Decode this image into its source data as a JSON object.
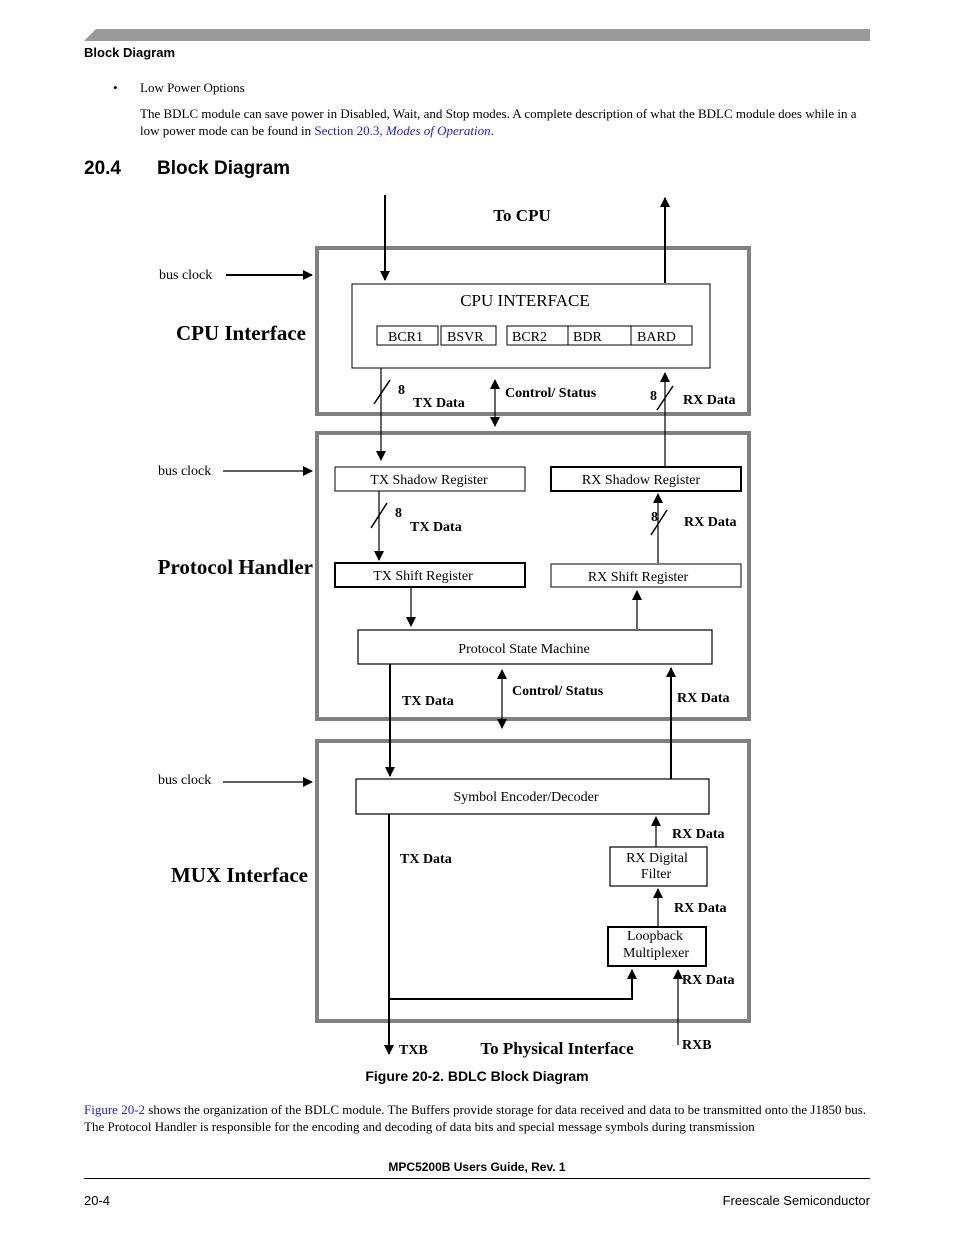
{
  "page": {
    "running_head": "Block Diagram",
    "bullet_char": "•",
    "bullet_label": "Low Power Options",
    "intro_text_1": "The BDLC module can save power in Disabled, Wait, and Stop modes. A complete description of what the BDLC module does while in a low power mode can be found in ",
    "intro_link_section": "Section 20.3, ",
    "intro_link_title": "Modes of Operation",
    "intro_text_end": ".",
    "section_number": "20.4",
    "section_title": "Block Diagram",
    "figure_caption": "Figure 20-2. BDLC Block Diagram",
    "body_link": "Figure 20-2",
    "body_text": " shows the organization of the BDLC module. The Buffers provide storage for data received and data to be transmitted onto the J1850 bus. The Protocol Handler is responsible for the encoding and decoding of data bits and special message symbols during transmission",
    "footer_title": "MPC5200B Users Guide, Rev. 1",
    "page_number": "20-4",
    "company": "Freescale Semiconductor",
    "colors": {
      "header_bar": "#9a9a9a",
      "block_border": "#808080",
      "link": "#1a1aff"
    }
  },
  "diagram": {
    "to_cpu": "To CPU",
    "to_physical": "To Physical Interface",
    "bus_clock": "bus clock",
    "txb": "TXB",
    "rxb": "RXB",
    "tx_data": "TX Data",
    "rx_data": "RX Data",
    "control_status": "Control/ Status",
    "width_8": "8",
    "cpu_block": {
      "label": "CPU Interface",
      "inner_title": "CPU INTERFACE",
      "registers": [
        "BCR1",
        "BSVR",
        "BCR2",
        "BDR",
        "BARD"
      ]
    },
    "protocol_block": {
      "label": "Protocol Handler",
      "tx_shadow": "TX Shadow Register",
      "rx_shadow": "RX Shadow Register",
      "tx_shift": "TX Shift Register",
      "rx_shift": "RX Shift Register",
      "state_machine": "Protocol State Machine"
    },
    "mux_block": {
      "label": "MUX Interface",
      "encoder": "Symbol Encoder/Decoder",
      "rx_filter_1": "RX Digital",
      "rx_filter_2": "Filter",
      "loopback_1": "Loopback",
      "loopback_2": "Multiplexer"
    }
  }
}
